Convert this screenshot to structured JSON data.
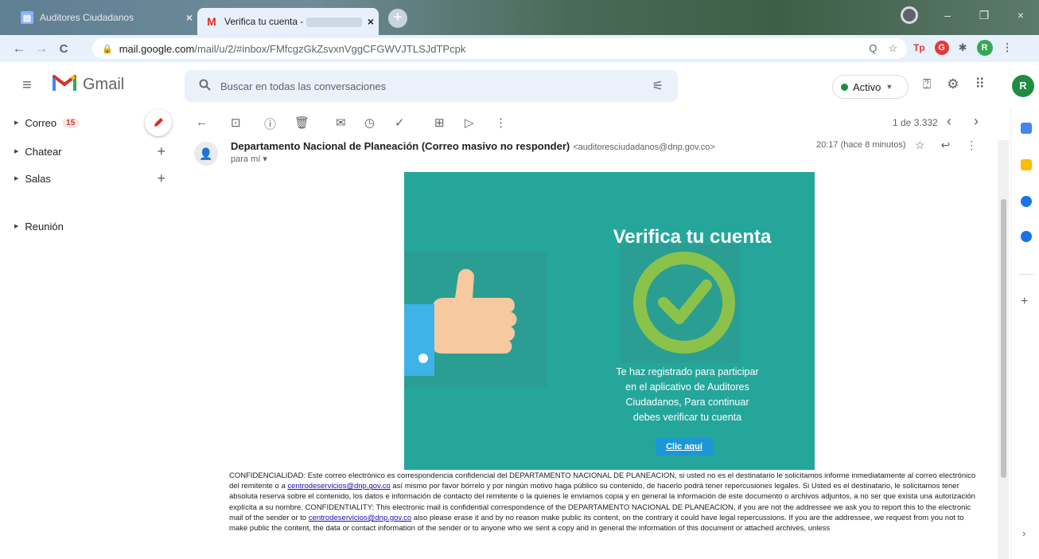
{
  "browser": {
    "tabs": [
      {
        "title": "Auditores Ciudadanos",
        "close": "×"
      },
      {
        "title": "Verifica tu cuenta -",
        "close": "×"
      }
    ],
    "newtab": "+",
    "window_controls": {
      "minimize": "–",
      "maximize": "❐",
      "close": "×"
    },
    "nav": {
      "back": "←",
      "forward": "→",
      "reload": "C"
    },
    "url": {
      "host": "mail.google.com",
      "path": "/mail/u/2/#inbox/FMfcgzGkZsvxnVggCFGWVJTLSJdTPcpk"
    },
    "omnibox_icons": {
      "zoom": "Q",
      "star": "☆"
    },
    "extensions": {
      "tp": "Tp",
      "g": "G",
      "puzzle": "✱",
      "profile": "R",
      "menu": "⋮"
    }
  },
  "gmail": {
    "logo_text": "Gmail",
    "search_placeholder": "Buscar en todas las conversaciones",
    "status": "Activo",
    "avatar": "R"
  },
  "sidebar": {
    "items": [
      {
        "label": "Correo",
        "badge": "15"
      },
      {
        "label": "Chatear",
        "action": "+"
      },
      {
        "label": "Salas",
        "action": "+"
      },
      {
        "label": "Reunión"
      }
    ]
  },
  "toolbar": {
    "count": "1 de 3.332",
    "prev": "‹",
    "next": "›"
  },
  "message": {
    "sender_name": "Departamento Nacional de Planeación (Correo masivo no responder)",
    "sender_email": "<auditoresciudadanos@dnp.gov.co>",
    "to": "para mí ▾",
    "time": "20:17 (hace 8 minutos)"
  },
  "email_card": {
    "title": "Verifica tu cuenta",
    "text_lines": [
      "Te haz registrado para participar",
      "en el aplicativo de Auditores",
      "Ciudadanos, Para continuar",
      "debes verificar tu cuenta"
    ],
    "button": "Clic aquí"
  },
  "disclaimer": {
    "p1": "CONFIDENCIALIDAD: Este correo electrónico es correspondencia confidencial del DEPARTAMENTO NACIONAL DE PLANEACION, si usted no es el destinatario le solicitamos informe inmediatamente al correo electrónico del remitente o a ",
    "link1": "centrodeservicios@dnp.gov.co",
    "p2": " así mismo por favor bórrelo y por ningún motivo haga público su contenido, de hacerlo podrá tener repercusiones legales. Si Usted es el destinatario, le solicitamos tener absoluta reserva sobre el contenido, los datos e información de contacto del remitente o la quienes le enviamos copia y en general la información de este documento o archivos adjuntos, a no ser que exista una autorización explícita a su nombre. CONFIDENTIALITY: This electronic mail is confidential correspondence of the DEPARTAMENTO NACIONAL DE PLANEACION, if you are not the addressee we ask you to report this to the electronic mail of the sender or to ",
    "link2": "centrodeservicios@dnp.gov.co",
    "p3": " also please erase it and by no reason make public its content, on the contrary it could have legal repercussions. If you are the addressee, we request from you not to make public the content, the data or contact information of the sender or to anyone who we sent a copy and in general the information of this document or attached archives, unless"
  },
  "colors": {
    "card_bg": "#25a69a",
    "card_button": "#1c96d6",
    "gmail_red": "#d93025",
    "status_green": "#1e8e3e"
  }
}
